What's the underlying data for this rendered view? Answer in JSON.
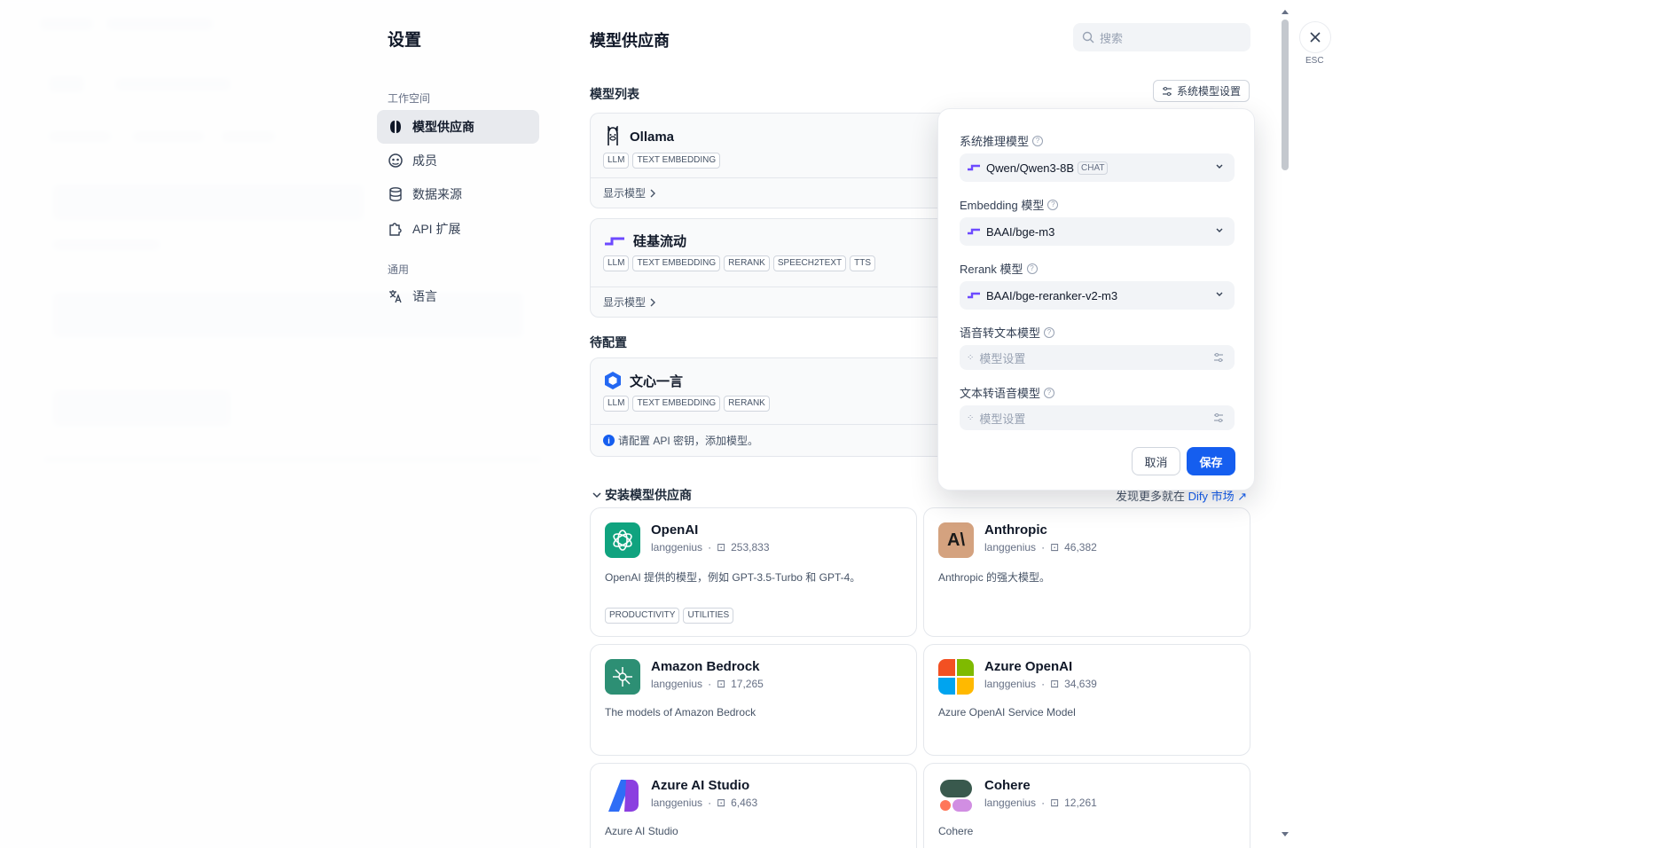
{
  "settings": {
    "title": "设置",
    "workspace_label": "工作空间",
    "general_label": "通用",
    "nav": [
      {
        "label": "模型供应商"
      },
      {
        "label": "成员"
      },
      {
        "label": "数据来源"
      },
      {
        "label": "API 扩展"
      },
      {
        "label": "语言"
      }
    ]
  },
  "main": {
    "title": "模型供应商",
    "search_placeholder": "搜索",
    "model_list_label": "模型列表",
    "system_model_button": "系统模型设置",
    "pending_label": "待配置",
    "providers": [
      {
        "name": "Ollama",
        "tags": [
          "LLM",
          "TEXT EMBEDDING"
        ],
        "footer": "显示模型"
      },
      {
        "name": "硅基流动",
        "tags": [
          "LLM",
          "TEXT EMBEDDING",
          "RERANK",
          "SPEECH2TEXT",
          "TTS"
        ],
        "footer": "显示模型"
      }
    ],
    "pending": [
      {
        "name": "文心一言",
        "tags": [
          "LLM",
          "TEXT EMBEDDING",
          "RERANK"
        ],
        "footer": "请配置 API 密钥，添加模型。"
      }
    ],
    "install_title": "安装模型供应商",
    "market_prefix": "发现更多就在",
    "market_link": "Dify 市场",
    "marketplace": [
      {
        "name": "OpenAI",
        "author": "langgenius",
        "installs": "253,833",
        "desc": "OpenAI 提供的模型，例如 GPT-3.5-Turbo 和 GPT-4。",
        "tags": [
          "PRODUCTIVITY",
          "UTILITIES"
        ]
      },
      {
        "name": "Anthropic",
        "author": "langgenius",
        "installs": "46,382",
        "desc": "Anthropic 的强大模型。",
        "tags": []
      },
      {
        "name": "Amazon Bedrock",
        "author": "langgenius",
        "installs": "17,265",
        "desc": "The models of Amazon Bedrock",
        "tags": []
      },
      {
        "name": "Azure OpenAI",
        "author": "langgenius",
        "installs": "34,639",
        "desc": "Azure OpenAI Service Model",
        "tags": []
      },
      {
        "name": "Azure AI Studio",
        "author": "langgenius",
        "installs": "6,463",
        "desc": "Azure AI Studio",
        "tags": []
      },
      {
        "name": "Cohere",
        "author": "langgenius",
        "installs": "12,261",
        "desc": "Cohere",
        "tags": []
      }
    ]
  },
  "popover": {
    "reasoning_label": "系统推理模型",
    "reasoning_value": "Qwen/Qwen3-8B",
    "reasoning_badge": "CHAT",
    "embedding_label": "Embedding 模型",
    "embedding_value": "BAAI/bge-m3",
    "rerank_label": "Rerank 模型",
    "rerank_value": "BAAI/bge-reranker-v2-m3",
    "stt_label": "语音转文本模型",
    "stt_placeholder": "模型设置",
    "tts_label": "文本转语音模型",
    "tts_placeholder": "模型设置",
    "cancel": "取消",
    "save": "保存"
  },
  "close_hint": "ESC",
  "colors": {
    "accent": "#155eef",
    "siliconflow": "#6d4aff"
  }
}
